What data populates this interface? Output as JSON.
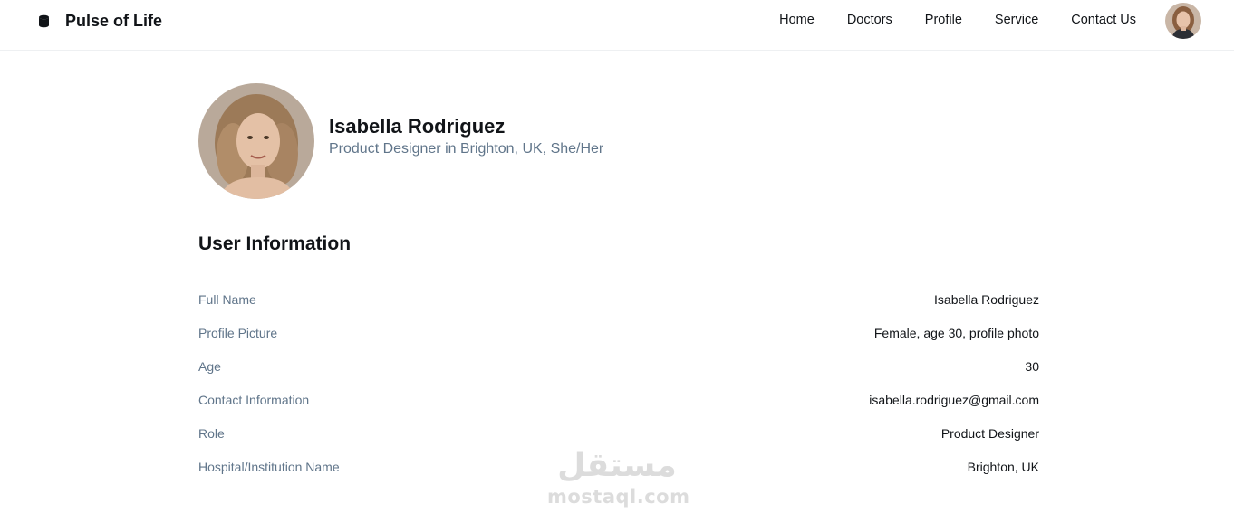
{
  "header": {
    "brand": "Pulse of Life",
    "brand_icon": "database-icon",
    "nav": [
      "Home",
      "Doctors",
      "Profile",
      "Service",
      "Contact Us"
    ],
    "avatar_icon": "user-avatar"
  },
  "profile": {
    "name": "Isabella Rodriguez",
    "subtitle": "Product Designer in Brighton, UK, She/Her"
  },
  "user_information": {
    "title": "User Information",
    "rows": [
      {
        "label": "Full Name",
        "value": "Isabella Rodriguez"
      },
      {
        "label": "Profile Picture",
        "value": "Female, age 30, profile photo"
      },
      {
        "label": "Age",
        "value": "30"
      },
      {
        "label": "Contact Information",
        "value": "isabella.rodriguez@gmail.com"
      },
      {
        "label": "Role",
        "value": "Product Designer"
      },
      {
        "label": "Hospital/Institution Name",
        "value": "Brighton, UK"
      }
    ]
  },
  "watermark": {
    "logo": "مستقل",
    "url": "mostaql.com"
  },
  "colors": {
    "text_primary": "#111418",
    "text_secondary": "#60758a",
    "border": "#eef0f2",
    "watermark": "#d6d6d6"
  }
}
